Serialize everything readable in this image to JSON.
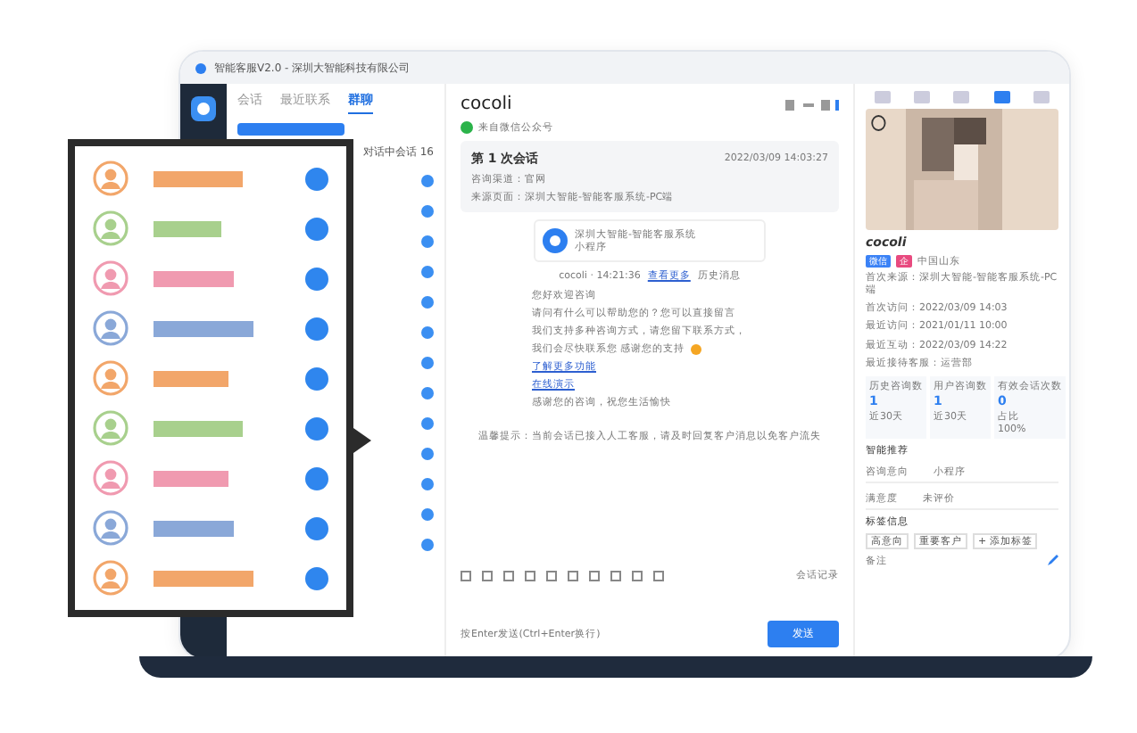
{
  "window": {
    "title": "智能客服V2.0 - 深圳大智能科技有限公司"
  },
  "list_panel": {
    "tabs": [
      {
        "label": "会话",
        "selected": false
      },
      {
        "label": "最近联系",
        "selected": false
      },
      {
        "label": "群聊",
        "selected": true
      }
    ],
    "status": "对话中会话 16",
    "rows": [
      {
        "unread": true
      },
      {
        "unread": true
      },
      {
        "unread": true
      },
      {
        "unread": true
      },
      {
        "unread": true
      },
      {
        "unread": true
      },
      {
        "unread": true
      },
      {
        "unread": true
      },
      {
        "unread": true
      },
      {
        "unread": true
      },
      {
        "unread": true
      },
      {
        "unread": true
      },
      {
        "unread": true
      }
    ]
  },
  "overlay": {
    "contacts": [
      {
        "color": "#f2a66a",
        "checked": true
      },
      {
        "color": "#a8d08d",
        "checked": true
      },
      {
        "color": "#f09ab0",
        "checked": true
      },
      {
        "color": "#8aa8d8",
        "checked": true
      },
      {
        "color": "#f2a66a",
        "checked": true
      },
      {
        "color": "#a8d08d",
        "checked": true
      },
      {
        "color": "#f09ab0",
        "checked": true
      },
      {
        "color": "#8aa8d8",
        "checked": true
      },
      {
        "color": "#f2a66a",
        "checked": true
      }
    ]
  },
  "chat": {
    "name": "cocoli",
    "source": "来自微信公众号",
    "session": {
      "title": "第 1 次会话",
      "time": "2022/03/09 14:03:27",
      "lines": [
        "咨询渠道：官网",
        "来源页面：深圳大智能-智能客服系统-PC端"
      ]
    },
    "card": {
      "title": "深圳大智能-智能客服系统",
      "subtitle": "小程序",
      "meta": "cocoli · 14:21:36",
      "link": "查看更多",
      "extra": "历史消息"
    },
    "messages": [
      {
        "kind": "text",
        "text": "您好欢迎咨询"
      },
      {
        "kind": "text",
        "text": "请问有什么可以帮助您的？您可以直接留言"
      },
      {
        "kind": "text",
        "text": "我们支持多种咨询方式，请您留下联系方式，"
      },
      {
        "kind": "emoji",
        "text": "我们会尽快联系您 感谢您的支持"
      },
      {
        "kind": "link",
        "text": "了解更多功能"
      },
      {
        "kind": "link",
        "text": "在线演示"
      },
      {
        "kind": "text",
        "text": "感谢您的咨询，祝您生活愉快"
      }
    ],
    "notice": "温馨提示：当前会话已接入人工客服，请及时回复客户消息以免客户流失",
    "history": "会话记录",
    "hint": "按Enter发送(Ctrl+Enter换行)",
    "send": "发送"
  },
  "profile": {
    "tabs": [
      {
        "selected": false
      },
      {
        "selected": false
      },
      {
        "selected": false
      },
      {
        "selected": true
      },
      {
        "selected": false
      }
    ],
    "name": "cocoli",
    "tags": [
      {
        "label": "微信",
        "color": "#3b82f6"
      },
      {
        "label": "企",
        "color": "#e84a7f"
      }
    ],
    "location": "中国山东",
    "info": [
      "首次来源：深圳大智能-智能客服系统-PC端",
      "首次访问：2022/03/09 14:03",
      "最近访问：2021/01/11 10:00",
      "最近互动：2022/03/09 14:22",
      "最近接待客服：运营部"
    ],
    "stats": [
      {
        "label": "历史咨询数",
        "value": "1",
        "sub": "近30天"
      },
      {
        "label": "用户咨询数",
        "value": "1",
        "sub": "近30天"
      },
      {
        "label": "有效会话次数",
        "value": "0",
        "sub": "占比",
        "rate": "100%"
      }
    ],
    "recommend": "智能推荐",
    "fields": [
      {
        "label": "咨询意向",
        "value": "小程序"
      },
      {
        "label": "满意度",
        "value": "未评价"
      }
    ],
    "tag_title": "标签信息",
    "user_tags": [
      "高意向",
      "重要客户",
      "+ 添加标签"
    ],
    "note": "备注"
  }
}
